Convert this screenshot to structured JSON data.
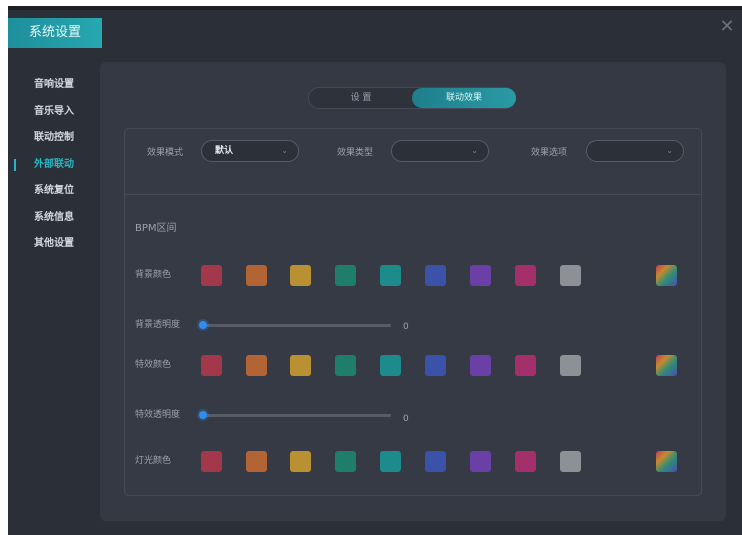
{
  "window": {
    "title": "系统设置",
    "close": "✕"
  },
  "nav": {
    "items": [
      {
        "label": "音响设置"
      },
      {
        "label": "音乐导入"
      },
      {
        "label": "联动控制"
      },
      {
        "label": "外部联动",
        "active": true
      },
      {
        "label": "系统复位"
      },
      {
        "label": "系统信息"
      },
      {
        "label": "其他设置"
      }
    ]
  },
  "tabs": {
    "left": "设 置",
    "right": "联动效果",
    "active": "right"
  },
  "filters": {
    "mode_label": "效果模式",
    "mode_value": "默认",
    "type_label": "效果类型",
    "type_value": "",
    "option_label": "效果选项",
    "option_value": ""
  },
  "bpm_label": "BPM区间",
  "rows": {
    "bg_color_label": "背景颜色",
    "bg_opacity_label": "背景透明度",
    "bg_opacity_value": "0",
    "fx_color_label": "特效颜色",
    "fx_opacity_label": "特效透明度",
    "fx_opacity_value": "0",
    "light_color_label": "灯光颜色"
  },
  "palette": [
    "#a2384a",
    "#b26435",
    "#b99133",
    "#1f7d6b",
    "#1d8a8c",
    "#3a53a8",
    "#6a3fa6",
    "#a3306b",
    "#8d9095",
    "multicolor"
  ],
  "colors": {
    "accent": "#2ab5c2",
    "knob": "#2f8df0",
    "bg": "#2b2f38",
    "panel": "#343944"
  }
}
